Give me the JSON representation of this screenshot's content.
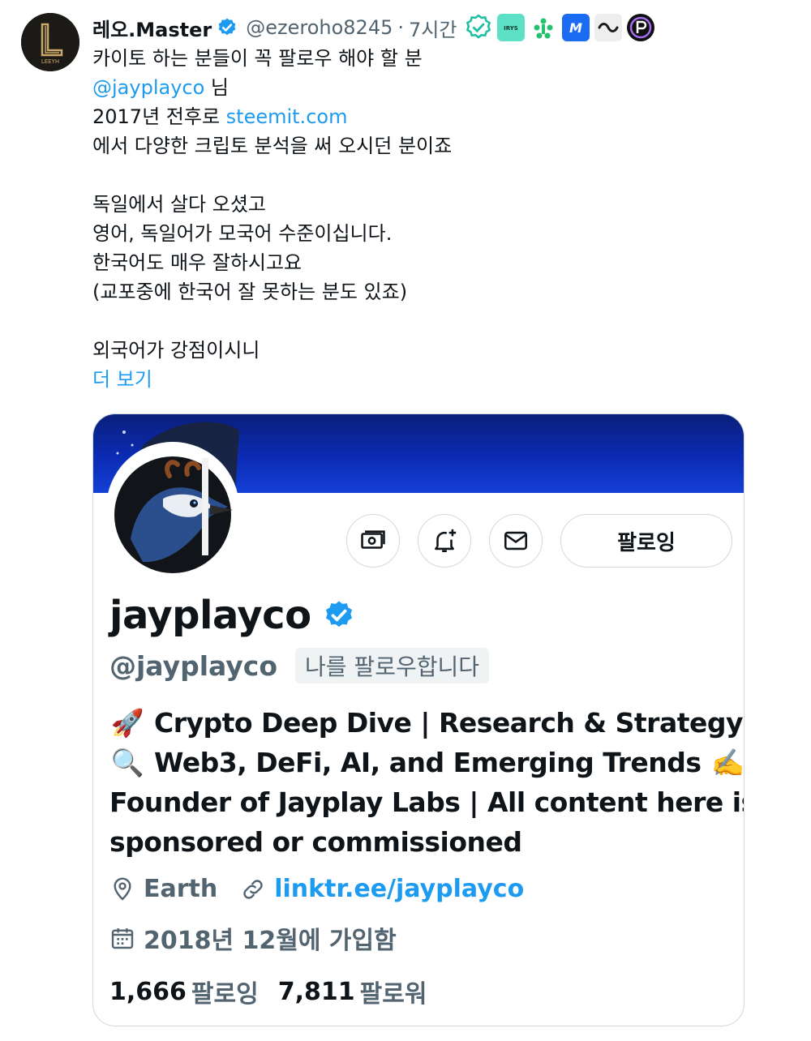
{
  "tweet": {
    "author": {
      "display_name": "레오.Master",
      "handle": "@ezeroho8245",
      "avatar_logo_text": "LEEYH"
    },
    "separator": "·",
    "time": "7시간",
    "affiliate_badges": [
      {
        "icon": "teal-verified-badge-icon",
        "color": "#1dbfa0"
      },
      {
        "icon": "irys-logo-icon",
        "label": "IRYS",
        "color": "#5de0c6"
      },
      {
        "icon": "green-cluster-logo-icon",
        "color": "#23c26f"
      },
      {
        "icon": "blue-m-logo-icon",
        "label": "M",
        "color": "#1b6cf2"
      },
      {
        "icon": "wave-logo-icon",
        "color": "#1a1a1a"
      },
      {
        "icon": "purple-p-logo-icon",
        "color": "#4a1a8c"
      }
    ],
    "body": {
      "line1": "카이토 하는 분들이 꼭 팔로우 해야 할 분",
      "mention": "@jayplayco",
      "mention_suffix": " 님",
      "line3_prefix": "2017년 전후로 ",
      "line3_link": "steemit.com",
      "line4": "에서 다양한 크립토 분석을 써 오시던 분이죠",
      "line6": "독일에서 살다 오셨고",
      "line7": "영어, 독일어가 모국어 수준이십니다.",
      "line8": "한국어도 매우 잘하시고요",
      "line9": "(교포중에 한국어 잘 못하는 분도 있죠)",
      "line11": "외국어가 강점이시니",
      "show_more": "더 보기"
    }
  },
  "profile_card": {
    "name": "jayplayco",
    "handle": "@jayplayco",
    "follows_you": "나를 팔로우합니다",
    "follow_button": "팔로잉",
    "bio": [
      {
        "emoji": "🚀",
        "text": "Crypto Deep Dive | Research & Strategy"
      },
      {
        "emoji": "🔍",
        "text": "Web3, DeFi, AI, and Emerging Trends",
        "trailing_emoji": "✍️"
      },
      {
        "text": "Founder of Jayplay Labs | All content here is"
      },
      {
        "text": "sponsored or commissioned"
      }
    ],
    "location": "Earth",
    "website": "linktr.ee/jayplayco",
    "joined": "2018년 12월에 가입함",
    "following_count": "1,666",
    "following_label": "팔로잉",
    "followers_count": "7,811",
    "followers_label": "팔로워",
    "colors": {
      "accent": "#1d9bf0",
      "banner": "#0b2bb5",
      "secondary_text": "#536471"
    }
  }
}
